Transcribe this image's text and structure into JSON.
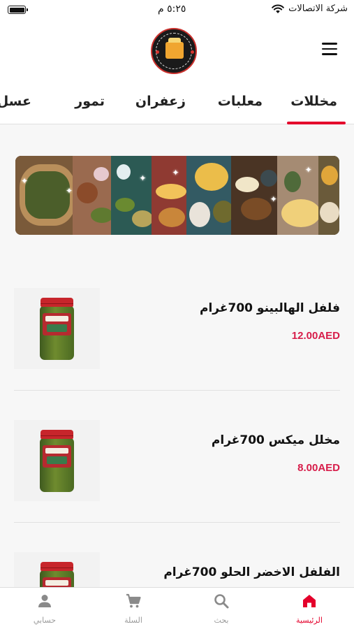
{
  "status_bar": {
    "time": "٥:٢٥ م",
    "carrier": "شركة الاتصالات",
    "battery_level": 1.0
  },
  "header": {
    "logo_text": "SOUQ AL LULU FOODSTUFF",
    "menu_icon": "hamburger-menu-icon"
  },
  "tabs": [
    {
      "label": "مخللات",
      "active": true
    },
    {
      "label": "معلبات",
      "active": false
    },
    {
      "label": "زعفران",
      "active": false
    },
    {
      "label": "تمور",
      "active": false
    },
    {
      "label": "عسل",
      "active": false
    }
  ],
  "products": [
    {
      "name": "فلفل الهالبينو 700غرام",
      "price": "12.00AED"
    },
    {
      "name": "مخلل ميكس 700غرام",
      "price": "8.00AED"
    },
    {
      "name": "الفلفل الاخضر الحلو 700غرام",
      "price": ""
    }
  ],
  "bottom_nav": [
    {
      "label": "الرئيسية",
      "icon": "home-icon",
      "active": true
    },
    {
      "label": "بحث",
      "icon": "search-icon",
      "active": false
    },
    {
      "label": "السلة",
      "icon": "cart-icon",
      "active": false
    },
    {
      "label": "حسابي",
      "icon": "account-icon",
      "active": false
    }
  ],
  "colors": {
    "accent": "#e4002b",
    "price": "#d71d4a",
    "text": "#111111",
    "background": "#f7f7f7"
  }
}
